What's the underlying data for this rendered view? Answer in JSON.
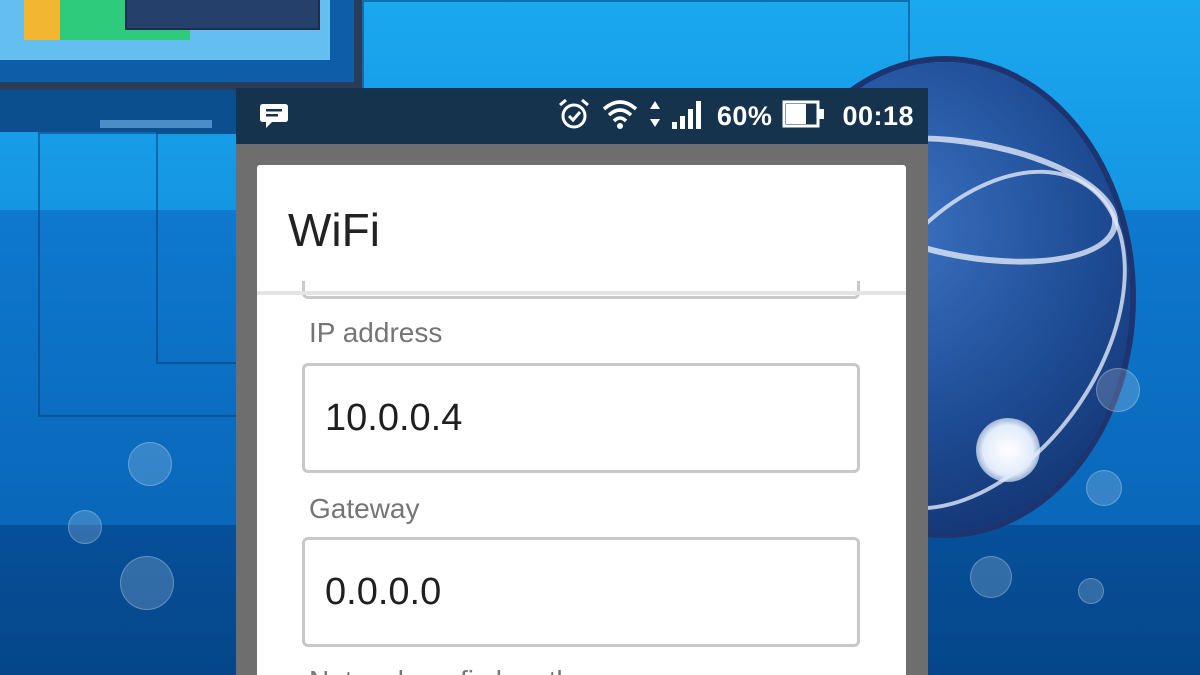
{
  "status_bar": {
    "battery_percent": "60%",
    "time": "00:18",
    "icons": [
      "message-icon",
      "alarm-icon",
      "wifi-icon",
      "data-arrows-icon",
      "signal-icon",
      "battery-icon"
    ]
  },
  "dialog": {
    "title": "WiFi",
    "fields": [
      {
        "label": "IP address",
        "value": "10.0.0.4"
      },
      {
        "label": "Gateway",
        "value": "0.0.0.0"
      },
      {
        "label": "Network prefix length"
      }
    ]
  },
  "colors": {
    "status_bar": "#16334d",
    "dialog_bg": "#ffffff",
    "field_border": "#c8c8c8",
    "label_text": "#757575",
    "background_blue": "#1596e3"
  }
}
